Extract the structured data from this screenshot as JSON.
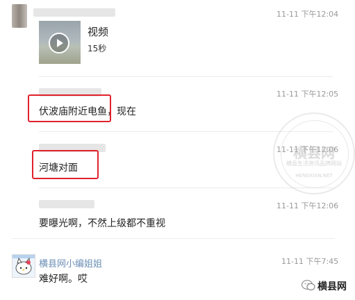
{
  "messages": [
    {
      "time": "11-11 下午12:04",
      "video": {
        "title": "视频",
        "duration": "15秒"
      }
    },
    {
      "time": "11-11 下午12:05",
      "text": "伏波庙附近电鱼，现在"
    },
    {
      "time": "11-11 下午12:06",
      "text": "河塘对面"
    },
    {
      "time": "11-11 下午12:06",
      "text": "要曝光啊，不然上级都不重视"
    },
    {
      "time": "11-11 下午7:45",
      "sender": "横县网小编姐姐",
      "text": "难好啊。哎"
    }
  ],
  "watermark": {
    "brand": "横县网",
    "tagline": "横县生活资讯品牌网站",
    "url": "HENGXIAN.NET"
  },
  "colors": {
    "highlight": "#e0212b",
    "accent_green": "#3cb371"
  }
}
